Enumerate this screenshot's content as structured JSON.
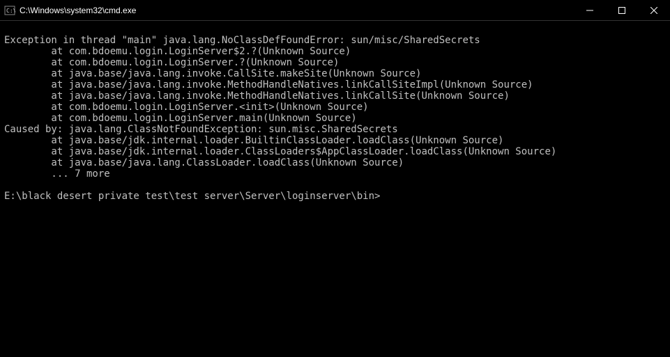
{
  "titlebar": {
    "title": "C:\\Windows\\system32\\cmd.exe"
  },
  "terminal": {
    "lines": [
      "",
      "Exception in thread \"main\" java.lang.NoClassDefFoundError: sun/misc/SharedSecrets",
      "        at com.bdoemu.login.LoginServer$2.?(Unknown Source)",
      "        at com.bdoemu.login.LoginServer.?(Unknown Source)",
      "        at java.base/java.lang.invoke.CallSite.makeSite(Unknown Source)",
      "        at java.base/java.lang.invoke.MethodHandleNatives.linkCallSiteImpl(Unknown Source)",
      "        at java.base/java.lang.invoke.MethodHandleNatives.linkCallSite(Unknown Source)",
      "        at com.bdoemu.login.LoginServer.<init>(Unknown Source)",
      "        at com.bdoemu.login.LoginServer.main(Unknown Source)",
      "Caused by: java.lang.ClassNotFoundException: sun.misc.SharedSecrets",
      "        at java.base/jdk.internal.loader.BuiltinClassLoader.loadClass(Unknown Source)",
      "        at java.base/jdk.internal.loader.ClassLoaders$AppClassLoader.loadClass(Unknown Source)",
      "        at java.base/java.lang.ClassLoader.loadClass(Unknown Source)",
      "        ... 7 more",
      ""
    ],
    "prompt": "E:\\black desert private test\\test server\\Server\\loginserver\\bin>"
  }
}
